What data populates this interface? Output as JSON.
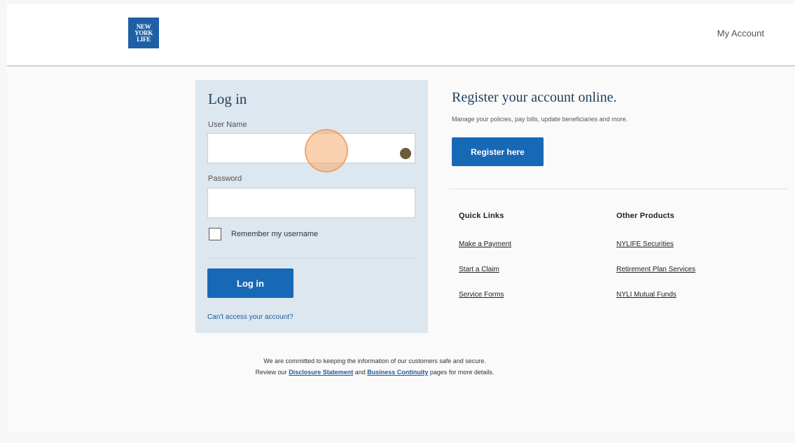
{
  "header": {
    "logo_lines": [
      "NEW",
      "YORK",
      "LIFE"
    ],
    "my_account": "My Account"
  },
  "login": {
    "title": "Log in",
    "username_label": "User Name",
    "username_value": "",
    "password_label": "Password",
    "password_value": "",
    "remember_label": "Remember my username",
    "remember_checked": false,
    "login_button": "Log in",
    "cant_access": "Can't access your account?"
  },
  "register": {
    "title": "Register your account online.",
    "subtitle": "Manage your policies, pay bills, update beneficiaries and more.",
    "button": "Register here"
  },
  "quick_links": {
    "title": "Quick Links",
    "items": [
      "Make a Payment",
      "Start a Claim",
      "Service Forms"
    ]
  },
  "other_products": {
    "title": "Other Products",
    "items": [
      "NYLIFE Securities",
      "Retirement Plan Services",
      "NYLI Mutual Funds"
    ]
  },
  "footer": {
    "line1": "We are committed to keeping the information of our customers safe and secure.",
    "line2_prefix": "Review our",
    "disclosure_link": "Disclosure Statement",
    "line2_and": "and",
    "continuity_link": "Business Continuity",
    "line2_suffix": "pages for more details."
  },
  "colors": {
    "brand_blue": "#1769b5",
    "panel_bg": "#dde7f0",
    "focus_highlight": "#f6ac6e"
  }
}
